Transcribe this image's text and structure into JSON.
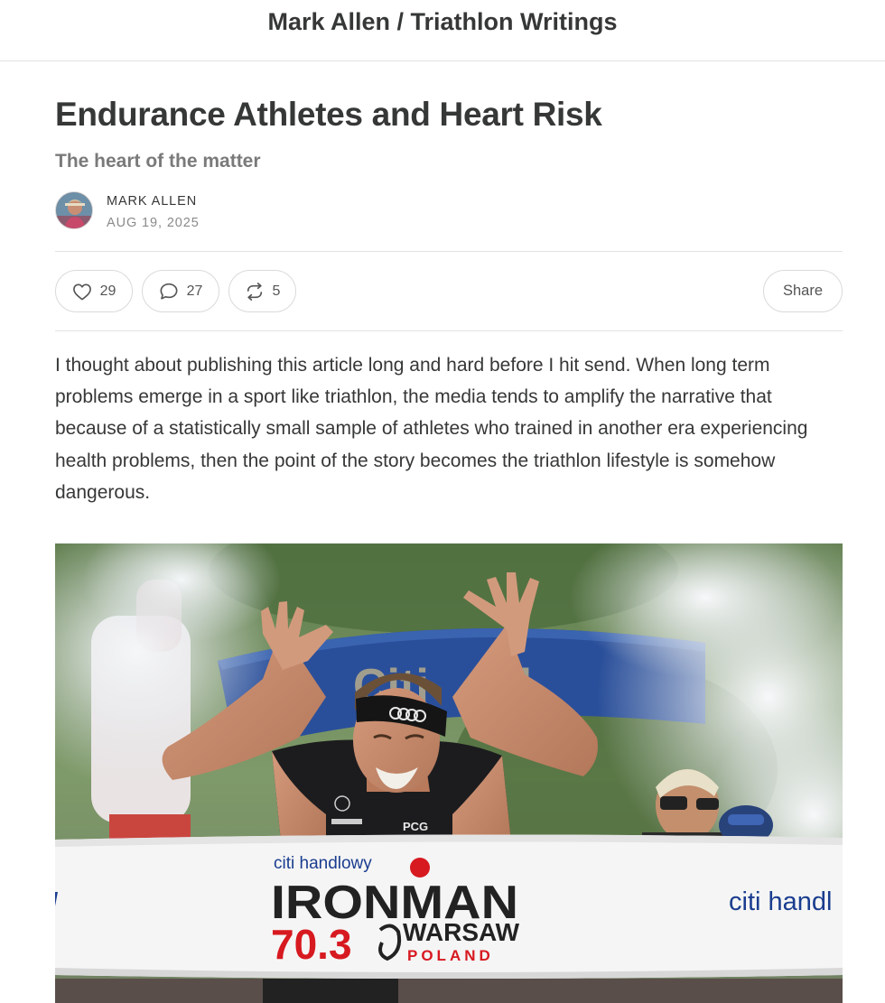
{
  "header": {
    "site_title": "Mark Allen / Triathlon Writings"
  },
  "post": {
    "title": "Endurance Athletes and Heart Risk",
    "subtitle": "The heart of the matter",
    "author": "MARK ALLEN",
    "date": "AUG 19, 2025",
    "body": "I thought about publishing this article long and hard before I hit send. When long term problems emerge in a sport like triathlon, the media tends to amplify the narrative that because of a statistically small sample of athletes who trained in another era experiencing health problems, then the point of the story becomes the triathlon lifestyle is somehow dangerous."
  },
  "actions": {
    "likes": "29",
    "comments": "27",
    "restacks": "5",
    "share_label": "Share"
  },
  "hero_image": {
    "banner_top": "citi handlowy",
    "logo_word": "IRONMAN",
    "race_distance": "70.3",
    "race_city": "WARSAW",
    "race_country": "POLAND",
    "banner_right": "citi handl",
    "arch_text": "Citi",
    "jersey_sponsor": "PCG"
  },
  "colors": {
    "text": "#363737",
    "muted": "#7a7a7a",
    "border": "#e2e2e2",
    "ironman_red": "#d71920",
    "citi_blue": "#1a3d8f"
  },
  "icons": {
    "like": "heart-icon",
    "comment": "comment-bubble-icon",
    "restack": "restack-arrows-icon"
  }
}
